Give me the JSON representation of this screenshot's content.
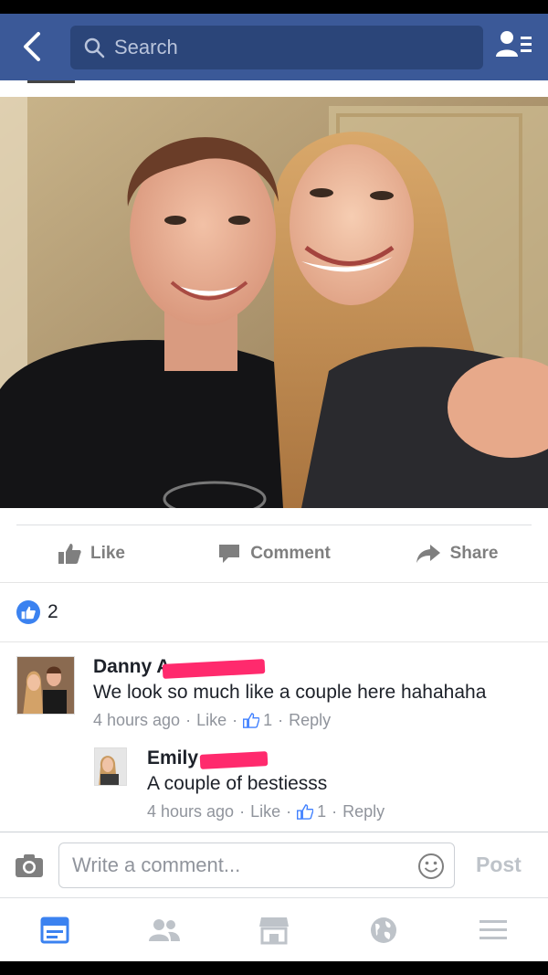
{
  "navbar": {
    "search_placeholder": "Search"
  },
  "actions": {
    "like": "Like",
    "comment": "Comment",
    "share": "Share"
  },
  "reactions": {
    "like_count": "2"
  },
  "comments": [
    {
      "name": "Danny A",
      "text": "We look so much like a couple here hahahaha",
      "time": "4 hours ago",
      "like": "Like",
      "likes": "1",
      "reply": "Reply"
    },
    {
      "name": "Emily",
      "text": "A couple of bestiesss",
      "time": "4 hours ago",
      "like": "Like",
      "likes": "1",
      "reply": "Reply"
    }
  ],
  "composer": {
    "placeholder": "Write a comment...",
    "post": "Post"
  },
  "tabs": [
    "news-feed",
    "friends",
    "marketplace",
    "notifications",
    "menu"
  ],
  "colors": {
    "brand": "#3b5998",
    "like_blue": "#3b82f0",
    "redaction": "#ff2a6d"
  }
}
